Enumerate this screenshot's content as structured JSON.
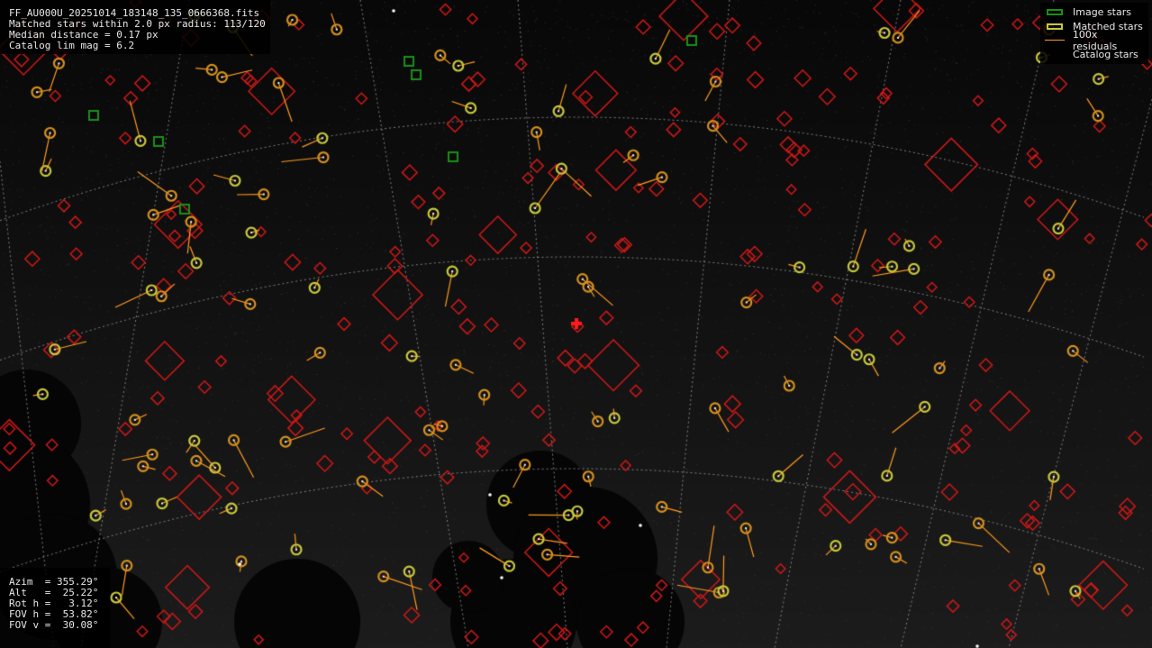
{
  "header": {
    "filename": "FF_AU000U_20251014_183148_135_0666368.fits",
    "matched_line": "Matched stars within 2.0 px radius: 113/120",
    "median_line": "Median distance = 0.17 px",
    "limmag_line": "Catalog lim mag = 6.2"
  },
  "pointing": {
    "azim": "Azim  = 355.29°",
    "alt": "Alt   =  25.22°",
    "rot": "Rot h =   3.12°",
    "fovh": "FOV h =  53.82°",
    "fovv": "FOV v =  30.08°"
  },
  "legend": {
    "image_stars": "Image stars",
    "matched_stars": "Matched stars",
    "residuals": "100x residuals",
    "catalog_stars": "Catalog stars"
  },
  "colors": {
    "image_star": "#1a8f1a",
    "matched_star": "#c8c83c",
    "residual": "#ff9a1f",
    "catalog_star": "#d01818",
    "grid": "#9a9a9a",
    "center_cross": "#ff1a1a"
  }
}
